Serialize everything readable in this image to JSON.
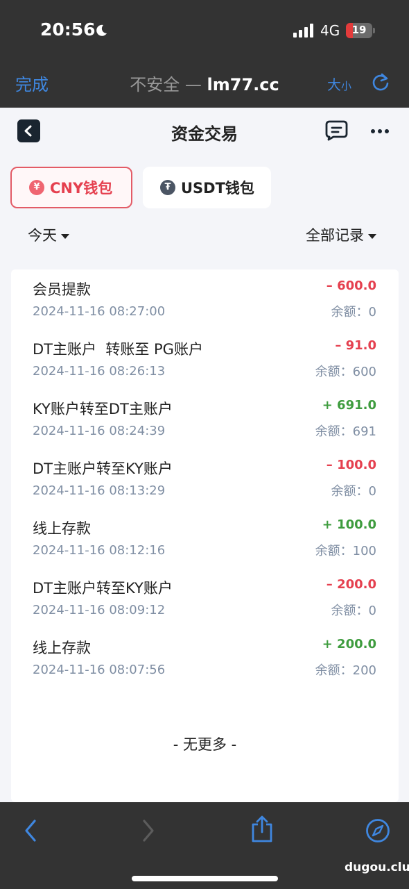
{
  "status": {
    "time": "20:56",
    "network": "4G",
    "battery": "19"
  },
  "browser": {
    "done_label": "完成",
    "insecure_label": "不安全 — ",
    "host": "lm77.cc",
    "text_size_big": "大",
    "text_size_small": "小"
  },
  "header": {
    "title": "资金交易"
  },
  "wallets": [
    {
      "label": "CNY钱包",
      "icon_glyph": "¥",
      "selected": true
    },
    {
      "label": "USDT钱包",
      "icon_glyph": "₮",
      "selected": false
    }
  ],
  "filters": {
    "date": "今天",
    "record_type": "全部记录"
  },
  "transactions": [
    {
      "title": "会员提款",
      "time": "2024-11-16 08:27:00",
      "amount": "– 600.0",
      "sign": "neg",
      "balance": "余额：0"
    },
    {
      "title": "DT主账户  转账至 PG账户",
      "time": "2024-11-16 08:26:13",
      "amount": "– 91.0",
      "sign": "neg",
      "balance": "余额：600"
    },
    {
      "title": "KY账户转至DT主账户",
      "time": "2024-11-16 08:24:39",
      "amount": "+ 691.0",
      "sign": "pos",
      "balance": "余额：691"
    },
    {
      "title": "DT主账户转至KY账户",
      "time": "2024-11-16 08:13:29",
      "amount": "– 100.0",
      "sign": "neg",
      "balance": "余额：0"
    },
    {
      "title": "线上存款",
      "time": "2024-11-16 08:12:16",
      "amount": "+ 100.0",
      "sign": "pos",
      "balance": "余额：100"
    },
    {
      "title": "DT主账户转至KY账户",
      "time": "2024-11-16 08:09:12",
      "amount": "– 200.0",
      "sign": "neg",
      "balance": "余额：0"
    },
    {
      "title": "线上存款",
      "time": "2024-11-16 08:07:56",
      "amount": "+ 200.0",
      "sign": "pos",
      "balance": "余额：200"
    }
  ],
  "list_end": "- 无更多 -",
  "watermark": "dugou.club",
  "colors": {
    "accent_blue": "#3f87e0",
    "negative": "#e5404f",
    "positive": "#3e9c3e",
    "muted": "#7f8ea3"
  }
}
